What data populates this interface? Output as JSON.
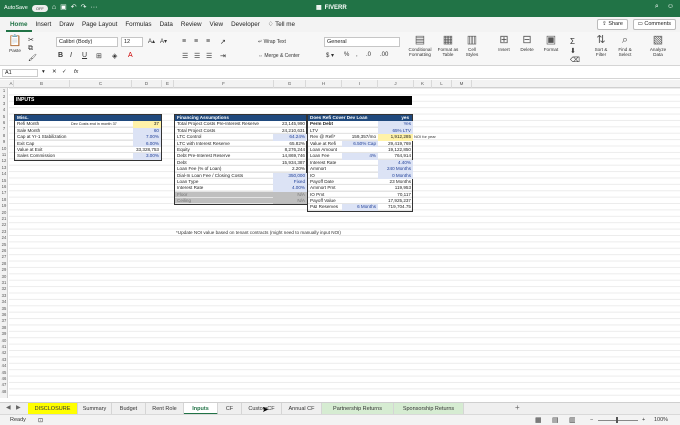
{
  "titlebar": {
    "autosave": "AutoSave",
    "autosave_state": "OFF",
    "title": "FIVERR"
  },
  "menu": {
    "items": [
      "Home",
      "Insert",
      "Draw",
      "Page Layout",
      "Formulas",
      "Data",
      "Review",
      "View",
      "Developer",
      "Tell me"
    ],
    "share": "Share",
    "comments": "Comments"
  },
  "ribbon": {
    "paste": "Paste",
    "font_name": "Calibri (Body)",
    "font_size": "12",
    "wrap_text": "Wrap Text",
    "merge_center": "Merge & Center",
    "number_format": "General",
    "conditional_formatting": "Conditional Formatting",
    "format_as_table": "Format as Table",
    "cell_styles": "Cell Styles",
    "insert": "Insert",
    "delete": "Delete",
    "format": "Format",
    "sort_filter": "Sort & Filter",
    "find_select": "Find & Select",
    "analyze_data": "Analyze Data"
  },
  "formula_bar": {
    "cell_ref": "A1",
    "fx": "fx"
  },
  "columns": [
    "A",
    "B",
    "C",
    "D",
    "E",
    "F",
    "G",
    "H",
    "I",
    "J",
    "K",
    "L",
    "M"
  ],
  "section_title": "INPUTS",
  "misc": {
    "header": "Misc.",
    "rows": [
      {
        "label": "Refi Month",
        "note": "Dev Costs end in month 37",
        "value": "37",
        "style": "yellow"
      },
      {
        "label": "Sale Month",
        "value": "60",
        "style": "inp"
      },
      {
        "label": "Cap at Yr-1 Stabilization",
        "value": "7.00%",
        "style": "inp"
      },
      {
        "label": "Exit Cap",
        "value": "6.00%",
        "style": "inp"
      },
      {
        "label": "Value at Exit",
        "value": "33,328,753",
        "style": ""
      },
      {
        "label": "Sales Commission",
        "value": "3.00%",
        "style": "inp"
      }
    ]
  },
  "financing": {
    "header": "Financing Assumptions",
    "rows": [
      {
        "label": "Total Project Costs Pre-Interest Reserve",
        "value": "23,145,990",
        "style": ""
      },
      {
        "label": "Total Project Costs",
        "value": "24,210,631",
        "style": ""
      },
      {
        "label": "LTC Control",
        "value": "64.24%",
        "style": "inp"
      },
      {
        "label": "LTC with Interest Reserve",
        "value": "65.82%",
        "style": ""
      },
      {
        "label": "Equity",
        "value": "8,276,244",
        "style": ""
      },
      {
        "label": "Debt Pre-Interest Reserve",
        "value": "14,869,746",
        "style": ""
      },
      {
        "label": "Debt",
        "value": "15,934,387",
        "style": ""
      },
      {
        "label": "Loan Fee (% of Loan)",
        "value": "2.20%",
        "style": ""
      },
      {
        "label": "Dial-In Loan Fee / Closing Costs",
        "value": "350,000",
        "style": "inp"
      },
      {
        "label": "Loan Type",
        "value": "Fixed",
        "style": "inp"
      },
      {
        "label": "Interest Rate",
        "value": "4.00%",
        "style": "inp"
      },
      {
        "label": "Floor",
        "value": "N/A",
        "style": "grey"
      },
      {
        "label": "Ceiling",
        "value": "N/A",
        "style": "grey"
      }
    ]
  },
  "refi": {
    "header": "Does Refi Cover Dev Loan",
    "header_value": "yes",
    "rows": [
      {
        "label": "Perm Debt",
        "mid": "",
        "value": "Yes",
        "style": "inp",
        "bold": true
      },
      {
        "label": "LTV",
        "mid": "",
        "value": "65% LTV",
        "style": "inp",
        "bold": false
      },
      {
        "label": "Rev @ Refi*",
        "mid": "159,357/mo",
        "value": "1,912,285",
        "style": "yellow",
        "bold": false,
        "extra": "NOI for year"
      },
      {
        "label": "Value at Refi",
        "mid": "6.50% Cap",
        "value": "29,419,769",
        "style": "",
        "bold": false
      },
      {
        "label": "Loan Amount",
        "mid": "",
        "value": "19,122,850",
        "style": "",
        "bold": false
      },
      {
        "label": "Loan Fee",
        "mid": "4%",
        "value": "764,914",
        "style": "",
        "bold": false
      },
      {
        "label": "Interest Rate",
        "mid": "",
        "value": "4.40%",
        "style": "inp",
        "bold": false
      },
      {
        "label": "Ammort",
        "mid": "",
        "value": "240 Months",
        "style": "inp",
        "bold": false
      },
      {
        "label": "IO",
        "mid": "",
        "value": "0 Months",
        "style": "inp",
        "bold": false
      },
      {
        "label": "Payoff Date",
        "mid": "",
        "value": "23 Months",
        "style": "",
        "bold": false
      },
      {
        "label": "Ammort Pmt",
        "mid": "",
        "value": "119,953",
        "style": "",
        "bold": false
      },
      {
        "label": "IO Pmt",
        "mid": "",
        "value": "70,117",
        "style": "",
        "bold": false
      },
      {
        "label": "Payoff Value",
        "mid": "",
        "value": "17,925,237",
        "style": "",
        "bold": false
      },
      {
        "label": "P&I Reserves",
        "mid": "6 Months",
        "value": "719,704.75",
        "style": "",
        "bold": false
      }
    ]
  },
  "note": "*Update NOI value based on tenant contracts (might need to manually input NOI)",
  "sheets": [
    {
      "label": "DISCLOSURE",
      "style": "yellowtab"
    },
    {
      "label": "Summary",
      "style": ""
    },
    {
      "label": "Budget",
      "style": ""
    },
    {
      "label": "Rent Role",
      "style": ""
    },
    {
      "label": "Inputs",
      "style": "active"
    },
    {
      "label": "CF",
      "style": ""
    },
    {
      "label": "CustomCF",
      "style": ""
    },
    {
      "label": "Annual CF",
      "style": ""
    },
    {
      "label": "Partnership Returns",
      "style": "greentab"
    },
    {
      "label": "Sponsorship Returns",
      "style": "greentab"
    }
  ],
  "status": {
    "ready": "Ready",
    "zoom": "100%"
  }
}
